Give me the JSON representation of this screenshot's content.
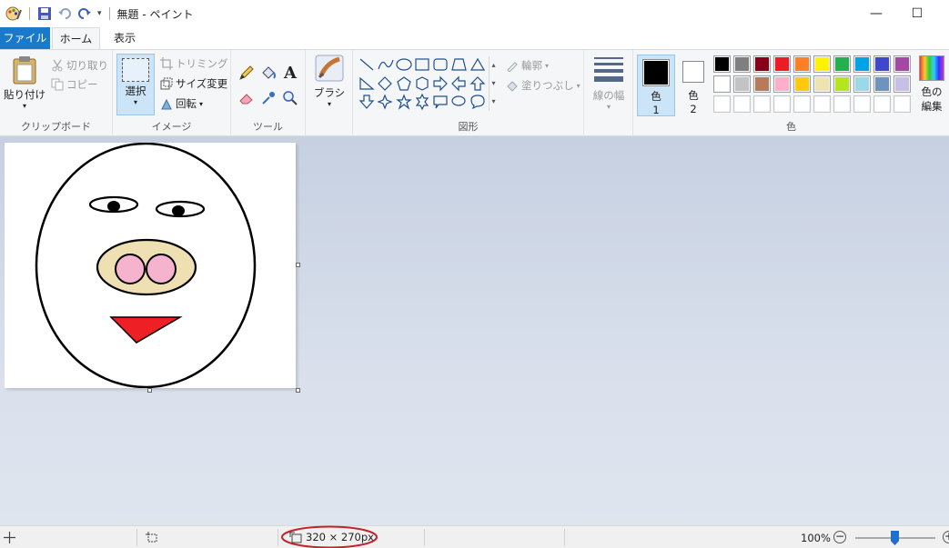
{
  "window": {
    "title": "無題 - ペイント",
    "minimize_label": "—",
    "maximize_label": "☐"
  },
  "tabs": {
    "file": "ファイル",
    "home": "ホーム",
    "view": "表示"
  },
  "clipboard": {
    "paste": "貼り付け",
    "cut": "切り取り",
    "copy": "コピー",
    "group": "クリップボード"
  },
  "image": {
    "select": "選択",
    "crop": "トリミング",
    "resize": "サイズ変更",
    "rotate": "回転",
    "group": "イメージ"
  },
  "tools": {
    "group": "ツール"
  },
  "brushes": {
    "label": "ブラシ"
  },
  "shapes": {
    "outline": "輪郭",
    "fill": "塗りつぶし",
    "group": "図形"
  },
  "size": {
    "label": "線の幅"
  },
  "colors": {
    "color1": "色",
    "color1_num": "1",
    "color2": "色",
    "color2_num": "2",
    "edit": "色の",
    "edit2": "編集",
    "group": "色",
    "color1_value": "#000000",
    "color2_value": "#ffffff",
    "palette": [
      "#000000",
      "#7f7f7f",
      "#880015",
      "#ed1c24",
      "#ff7f27",
      "#fff200",
      "#22b14c",
      "#00a2e8",
      "#3f48cc",
      "#a349a4",
      "#ffffff",
      "#c3c3c3",
      "#b97a57",
      "#ffaec9",
      "#ffc90e",
      "#efe4b0",
      "#b5e61d",
      "#99d9ea",
      "#7092be",
      "#c8bfe7"
    ]
  },
  "status": {
    "dimensions": "320 × 270px",
    "zoom": "100%"
  }
}
